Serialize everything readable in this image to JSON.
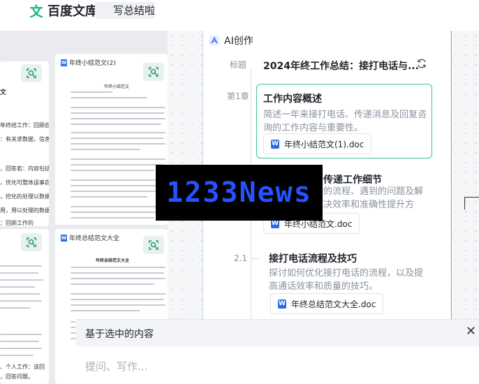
{
  "header": {
    "brand": "百度文库",
    "brand_mark": "文",
    "tab_label": "写总结啦"
  },
  "docs": {
    "card_left_top": {
      "cut_text": "文"
    },
    "card_right_top": {
      "title": "年终小结范文(2)",
      "doc_heading": "年终小结范文"
    },
    "card_right_bottom": {
      "title": "年终总结范文大全",
      "doc_heading": "年终总结范文大全"
    },
    "left_snippets": [
      "年终结工作：回顾自己",
      "：有关求数据，信息是",
      "，回答若：内容包括",
      "，优化可整体运事自己的",
      "，控化的处理以数据",
      "用，用以处理的数据：",
      "：回顾工作的",
      "、个人工作：该回",
      "，回答问题。"
    ]
  },
  "panel": {
    "title": "AI创作",
    "title_label": "标题",
    "heading": "2024年终工作总结：接打电话与...",
    "chapter_label": "第1章",
    "sections": [
      {
        "title": "工作内容概述",
        "desc": "简述一年来接打电话、传递消息及回复咨询的工作内容与重要性。",
        "file": "年终小结范文(1).doc"
      },
      {
        "title": "传递工作细节",
        "desc": "的流程、遇到的问题及解决效率和准确性提升方法。",
        "file": "年终小结范文.doc"
      },
      {
        "num": "2.1",
        "title": "接打电话流程及技巧",
        "desc": "探讨如何优化接打电话的流程，以及提高通话效率和质量的技巧。",
        "file": "年终总结范文大全.doc"
      }
    ]
  },
  "watermark": "1233News",
  "input": {
    "header": "基于选中的内容",
    "placeholder": "提问、写作..."
  },
  "colors": {
    "accent": "#14b77a",
    "word_blue": "#2b6be6",
    "watermark_blue": "#2453ff"
  }
}
